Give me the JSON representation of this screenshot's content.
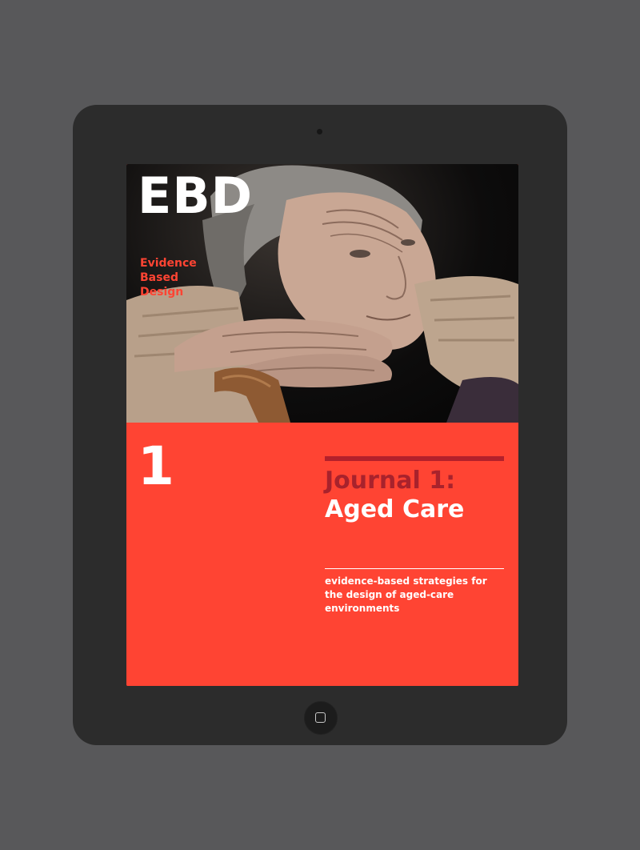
{
  "device": {
    "type": "tablet",
    "bezel_color": "#2c2c2c",
    "background_color": "#58585a"
  },
  "cover": {
    "brand": "EBD",
    "tagline": [
      "Evidence",
      "Based",
      "Design"
    ],
    "issue_number": "1",
    "journal_title": "Journal 1:",
    "subject_title": "Aged Care",
    "description": "evidence-based strategies for the design of aged-care environments",
    "accent_color": "#ff4433",
    "dark_accent_color": "#a8222c"
  },
  "icons": {
    "camera": "camera-icon",
    "home": "home-square-icon"
  }
}
